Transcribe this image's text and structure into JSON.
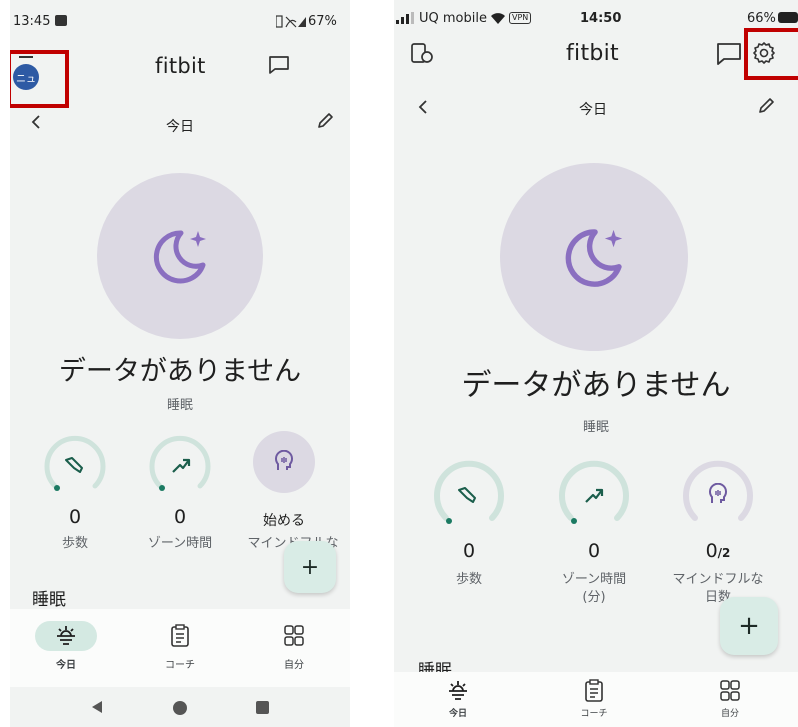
{
  "left": {
    "status": {
      "time": "13:45",
      "right": "67%"
    },
    "header": {
      "avatar_text": "ニュ",
      "app_name": "fitbit"
    },
    "date_row": {
      "label": "今日"
    },
    "sleep": {
      "message": "データがありません",
      "caption": "睡眠"
    },
    "metrics": [
      {
        "value": "0",
        "label": "歩数"
      },
      {
        "value": "0",
        "label": "ゾーン時間"
      },
      {
        "value": "始める",
        "label": "マインドフルな"
      }
    ],
    "fab_label": "+",
    "section_title": "睡眠",
    "nav": [
      {
        "label": "今日"
      },
      {
        "label": "コーチ"
      },
      {
        "label": "自分"
      }
    ]
  },
  "right": {
    "status": {
      "carrier": "UQ mobile",
      "vpn": "VPN",
      "time": "14:50",
      "battery": "66%"
    },
    "header": {
      "app_name": "fitbit"
    },
    "date_row": {
      "label": "今日"
    },
    "sleep": {
      "message": "データがありません",
      "caption": "睡眠"
    },
    "metrics": [
      {
        "value": "0",
        "label_line1": "歩数",
        "label_line2": ""
      },
      {
        "value": "0",
        "label_line1": "ゾーン時間",
        "label_line2": "(分)"
      },
      {
        "value": "0",
        "value_suffix": "/2",
        "label_line1": "マインドフルな",
        "label_line2": "日数"
      }
    ],
    "fab_label": "+",
    "section_title": "睡眠",
    "nav": [
      {
        "label": "今日"
      },
      {
        "label": "コーチ"
      },
      {
        "label": "自分"
      }
    ]
  },
  "colors": {
    "hero_circle": "#dcd9e3",
    "moon": "#8a6fc0",
    "ring": "#cfe3dc",
    "accent": "#1b7a62",
    "highlight": "#c00000"
  },
  "icons": [
    "avatar",
    "chat-icon",
    "back-icon",
    "edit-icon",
    "moon-stars-icon",
    "shoe-icon",
    "zone-icon",
    "mindful-icon",
    "plus-icon",
    "today-icon",
    "coach-icon",
    "you-icon",
    "device-icon",
    "settings-icon"
  ]
}
